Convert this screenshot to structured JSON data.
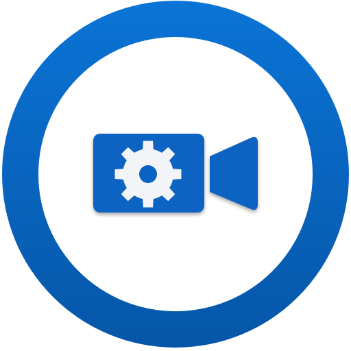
{
  "icon": {
    "name": "video-camera-settings-icon",
    "colors": {
      "ring_top": "#0a74d6",
      "ring_bottom": "#0656a8",
      "inner": "#ffffff",
      "glyph": "#0a63c2",
      "gear": "#f2f4f7"
    }
  }
}
